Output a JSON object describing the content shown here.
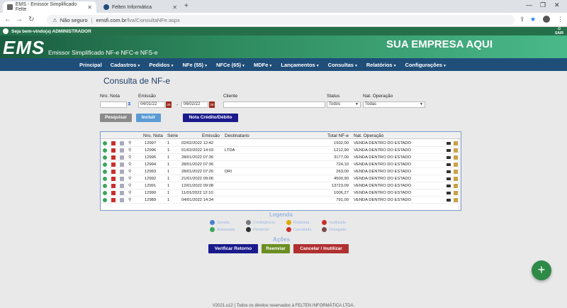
{
  "browser": {
    "tabs": [
      {
        "title": "EMS - Emissor Simplificado Felte",
        "active": true
      },
      {
        "title": "Felten Informática",
        "active": false
      }
    ],
    "new_tab": "+",
    "security_label": "Não seguro",
    "host": "emsfi.com.br",
    "path": "/lva/ConsultaNFe.aspx"
  },
  "header": {
    "welcome": "Seja bem-vindo(a) ADMINISTRADOR",
    "logout": "SAIR",
    "logo": "EMS",
    "subtitle": "Emissor Simplificado NF-e NFC-e NFS-e",
    "company": "SUA EMPRESA AQUI"
  },
  "menu": [
    {
      "label": "Principal",
      "caret": false
    },
    {
      "label": "Cadastros",
      "caret": true
    },
    {
      "label": "Pedidos",
      "caret": true
    },
    {
      "label": "NFe (55)",
      "caret": true
    },
    {
      "label": "NFCe (65)",
      "caret": true
    },
    {
      "label": "MDFe",
      "caret": true
    },
    {
      "label": "Lançamentos",
      "caret": true
    },
    {
      "label": "Consultas",
      "caret": true
    },
    {
      "label": "Relatórios",
      "caret": true
    },
    {
      "label": "Configurações",
      "caret": true
    }
  ],
  "page": {
    "title": "Consulta de NF-e"
  },
  "filters": {
    "nro_nota_label": "Nro. Nota",
    "emissao_label": "Emissão",
    "date_from": "04/01/22",
    "date_to": "06/02/22",
    "date_sep": "-",
    "cliente_label": "Cliente",
    "status_label": "Status",
    "status_value": "Todos",
    "natop_label": "Nat. Operação",
    "natop_value": "Todas"
  },
  "buttons": {
    "pesquisar": "Pesquisar",
    "incluir": "Incluir",
    "nota_credito": "Nota Crédito/Débito"
  },
  "grid": {
    "columns": [
      "Nro. Nota",
      "Série",
      "Emissão",
      "Destinatario",
      "Total NF-e",
      "Nat. Operação"
    ],
    "rows": [
      {
        "nro": "12997",
        "serie": "1",
        "emissao": "02/02/2022 12:42",
        "dest": "",
        "total": "1932,00",
        "natop": "VENDA DENTRO DO ESTADO"
      },
      {
        "nro": "12996",
        "serie": "1",
        "emissao": "01/02/2022 14:03",
        "dest": "LTDA",
        "total": "1212,90",
        "natop": "VENDA DENTRO DO ESTADO"
      },
      {
        "nro": "12995",
        "serie": "1",
        "emissao": "28/01/2022 07:36",
        "dest": "",
        "total": "3177,00",
        "natop": "VENDA DENTRO DO ESTADO"
      },
      {
        "nro": "12994",
        "serie": "1",
        "emissao": "28/01/2022 07:36",
        "dest": "",
        "total": "724,10",
        "natop": "VENDA DENTRO DO ESTADO"
      },
      {
        "nro": "12993",
        "serie": "1",
        "emissao": "28/01/2022 07:26",
        "dest": "DRI",
        "total": "263,00",
        "natop": "VENDA DENTRO DO ESTADO"
      },
      {
        "nro": "12992",
        "serie": "1",
        "emissao": "21/01/2022 09:06",
        "dest": "",
        "total": "4500,90",
        "natop": "VENDA DENTRO DO ESTADO"
      },
      {
        "nro": "12991",
        "serie": "1",
        "emissao": "12/01/2022 09:08",
        "dest": "",
        "total": "13723,09",
        "natop": "VENDA DENTRO DO ESTADO"
      },
      {
        "nro": "12990",
        "serie": "1",
        "emissao": "11/01/2022 12:10",
        "dest": "",
        "total": "1006,27",
        "natop": "VENDA DENTRO DO ESTADO"
      },
      {
        "nro": "12989",
        "serie": "1",
        "emissao": "04/01/2022 14:34",
        "dest": "",
        "total": "791,00",
        "natop": "VENDA DENTRO DO ESTADO"
      }
    ]
  },
  "legend": {
    "title": "Legenda",
    "items": [
      {
        "label": "Gerada",
        "color": "#4a7fd0"
      },
      {
        "label": "Contingência",
        "color": "#7a7a7a"
      },
      {
        "label": "Rejeitada",
        "color": "#e0a800"
      },
      {
        "label": "Inutilizada",
        "color": "#c9302c"
      },
      {
        "label": "Autorizada",
        "color": "#3ba559"
      },
      {
        "label": "Pendente",
        "color": "#333333"
      },
      {
        "label": "Cancelada",
        "color": "#c9302c"
      },
      {
        "label": "Denegada",
        "color": "#7a4a4a"
      }
    ]
  },
  "actions": {
    "title": "Ações",
    "verificar": "Verificar Retorno",
    "reenviar": "Reenviar",
    "cancelar": "Cancelar / Inutilizar"
  },
  "fab": "+",
  "footer": "V2021.u12 | Todos os direitos reservados à FELTEN INFORMÁTICA LTDA.",
  "colors": {
    "header_green": "#25704b",
    "menu_blue": "#1f4e79",
    "btn_gray": "#8a8a8a",
    "btn_blue": "#5b9bd5",
    "btn_navy": "#1a1a8c",
    "btn_green": "#6b8e23",
    "btn_red": "#b03030"
  }
}
